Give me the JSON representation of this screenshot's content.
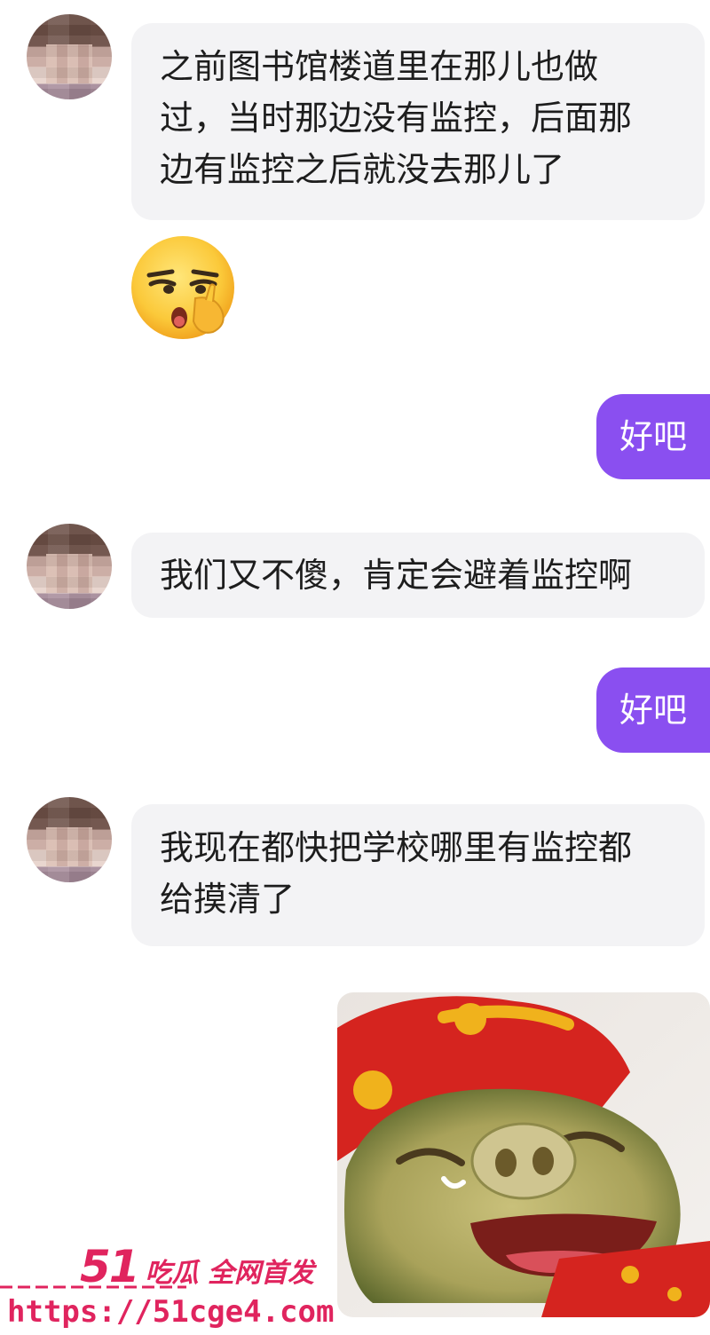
{
  "messages": [
    {
      "from": "other",
      "lines": [
        "之前图书馆楼道里在那儿也做",
        "过，当时那边没有监控，后面那",
        "边有监控之后就没去那儿了"
      ]
    },
    {
      "from": "other",
      "type": "sticker",
      "sticker": "shush-emoji"
    },
    {
      "from": "self",
      "text": "好吧"
    },
    {
      "from": "other",
      "lines": [
        "我们又不傻，肯定会避着监控啊"
      ]
    },
    {
      "from": "self",
      "text": "好吧"
    },
    {
      "from": "other",
      "lines": [
        "我现在都快把学校哪里有监控都",
        "给摸清了"
      ]
    },
    {
      "from": "self",
      "type": "image",
      "image": "laughing-pig-sticker"
    }
  ],
  "watermark": {
    "brand_number": "51",
    "brand_text": "吃瓜 全网首发",
    "url": "https://51cge4.com",
    "color": "#e0245e"
  },
  "colors": {
    "self_bubble": "#8a4ff0",
    "other_bubble": "#f3f3f5",
    "text": "#1d1d1d"
  }
}
